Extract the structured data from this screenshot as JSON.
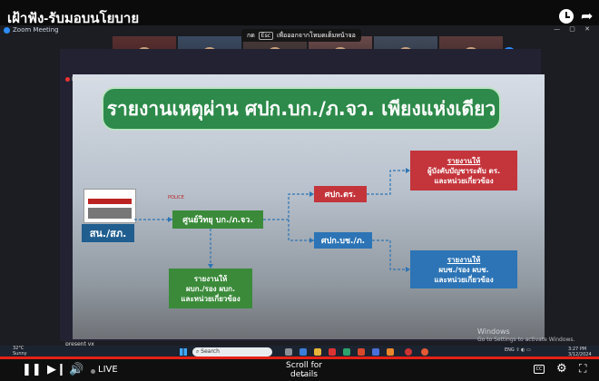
{
  "video": {
    "title": "เฝ้าฟัง-รับมอบนโยบาย",
    "zoom_title": "Zoom Meeting",
    "window_buttons": "— ▢ ✕"
  },
  "esc_banner": {
    "prefix": "กด",
    "key": "Esc",
    "text": "เพื่อออกจากโหมดเต็มหน้าจอ"
  },
  "recording": {
    "label": "Recording"
  },
  "slide": {
    "title": "รายงานเหตุผ่าน ศปก.บก./ภ.จว. เพียงแห่งเดียว",
    "police_sign": "POLICE",
    "source": "สน./สภ.",
    "center": "ศูนย์วิทยุ บก./ภ.จว.",
    "pk": "ศปก.ตร.",
    "pb": "ศปก.บช./ภ.",
    "red_title": "รายงานให้",
    "red_body_1": "ผู้บังคับบัญชาระดับ ตร.",
    "red_body_2": "และหน่วยเกี่ยวข้อง",
    "blue_title": "รายงานให้",
    "blue_body_1": "ผบช./รอง ผบช.",
    "blue_body_2": "และหน่วยเกี่ยวข้อง",
    "green_title": "รายงานให้",
    "green_body_1": "ผบก./รอง ผบก.",
    "green_body_2": "และหน่วยเกี่ยวข้อง"
  },
  "watermark": {
    "title": "Windows",
    "sub": "Go to Settings to activate Windows."
  },
  "present": "present vx",
  "taskbar": {
    "weather_temp": "32°C",
    "weather_desc": "Sunny",
    "search": "Search",
    "tray": "ENG  ⇪  ◐  ▭",
    "time": "3:27 PM",
    "date": "3/12/2024"
  },
  "player": {
    "live": "LIVE",
    "scroll": "Scroll for details",
    "cc": "CC",
    "progress": 1.0
  }
}
